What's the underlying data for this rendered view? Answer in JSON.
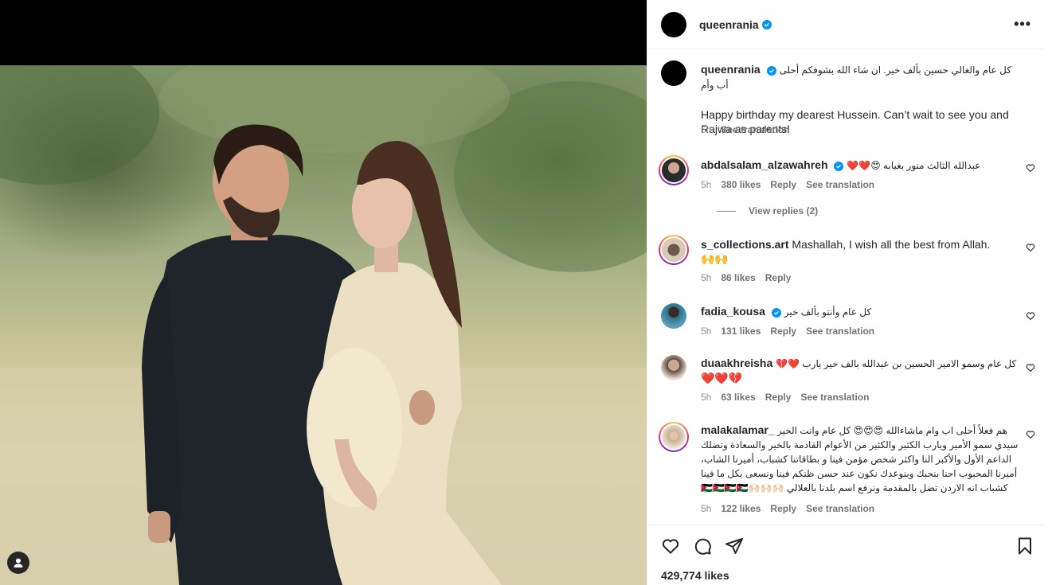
{
  "post": {
    "username": "queenrania",
    "verified": true,
    "more_label": "•••"
  },
  "caption": {
    "username": "queenrania",
    "text_ar": "كل عام والغالي حسين بألف خير. ان شاء الله بشوفكم أحلى أب وأم",
    "text_en": "Happy birthday my dearest Hussein. Can’t wait to see you and Rajwa as parents!",
    "time": "5h",
    "see_translation": "See translation"
  },
  "comments": [
    {
      "username": "abdalsalam_alzawahreh",
      "verified": true,
      "text": "❤️❤️😍 عبدالله الثالث منور بغيابه",
      "time": "5h",
      "likes": "380 likes",
      "reply": "Reply",
      "see_translation": "See translation",
      "view_replies": "View replies (2)"
    },
    {
      "username": "s_collections.art",
      "verified": false,
      "text": "Mashallah, I wish all the best from Allah.",
      "text2": "🙌🙌",
      "time": "5h",
      "likes": "86 likes",
      "reply": "Reply"
    },
    {
      "username": "fadia_kousa",
      "verified": true,
      "text": "كل عام وأنتو بألف خير",
      "time": "5h",
      "likes": "131 likes",
      "reply": "Reply",
      "see_translation": "See translation"
    },
    {
      "username": "duaakhreisha",
      "verified": false,
      "text": "💔❤️ كل عام وسمو الامير الحسين بن عبدالله بالف خير يارب",
      "text2": "❤️❤️💔",
      "time": "5h",
      "likes": "63 likes",
      "reply": "Reply",
      "see_translation": "See translation"
    },
    {
      "username": "malakalamar_",
      "verified": false,
      "text_lines": [
        "هم فعلاً أحلى اب وام ماشاءالله 😍😍😍 كل عام وانت الخير",
        "سيدي سمو الأمير ويارب الكثير والكثير من الأعوام القادمة بالخير والسعادة وتضلك",
        "الداعم الأول والأكبر النا واكثر شخص مؤمن فينا و بطاقاتنا كشباب، أميرنا الشاب،",
        "أميرنا المحبوب احنا بنحبك وبنوعدك نكون عند حسن ظنكم فينا ونسعى بكل ما فينا",
        "كشباب انه الاردن تضل بالمقدمة ونرفع اسم بلدنا بالعلالي 🙌🏻🙌🏻🙌🏻🇯🇴🇯🇴🇯🇴🇯🇴"
      ],
      "time": "5h",
      "likes": "122 likes",
      "reply": "Reply",
      "see_translation": "See translation"
    }
  ],
  "footer": {
    "likes": "429,774 likes"
  }
}
